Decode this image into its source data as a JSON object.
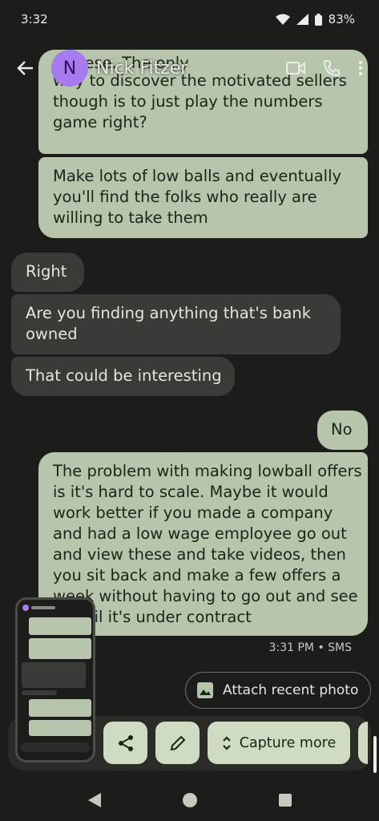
{
  "status": {
    "time": "3:32",
    "battery": "83%"
  },
  "header": {
    "avatar_letter": "N",
    "contact_name": "Nick Fitzer"
  },
  "messages": [
    {
      "dir": "out",
      "text": "...the motivated sellers though is to just play the numbers game right?",
      "lines": [
        "way to discover the motivated sellers",
        "though is to just play the numbers",
        "game right?"
      ]
    },
    {
      "dir": "out",
      "lines": [
        "Make lots of low balls and eventually",
        "you'll find the folks who really are",
        "willing to take them"
      ]
    },
    {
      "dir": "in",
      "lines": [
        "Right"
      ]
    },
    {
      "dir": "in",
      "lines": [
        "Are you finding anything that's bank",
        "owned"
      ]
    },
    {
      "dir": "in",
      "lines": [
        "That could be interesting"
      ]
    },
    {
      "dir": "out",
      "lines": [
        "No"
      ]
    },
    {
      "dir": "out",
      "lines": [
        "The problem with making lowball offers",
        "is it's hard to scale. Maybe it would",
        "work better if you made a company",
        "and had a low wage employee go out",
        "and view these and take videos, then",
        "you sit back and make a few offers a",
        "week without having to go out and see",
        "it until it's under contract"
      ]
    }
  ],
  "timestamp": "3:31 PM • SMS",
  "suggestion": {
    "label": "Attach recent photo"
  },
  "screenshot_tray": {
    "capture_label": "Capture more"
  },
  "icons": {
    "back": "arrow-left-icon",
    "video": "video-camera-icon",
    "call": "phone-icon",
    "more": "more-vert-icon",
    "image": "image-icon",
    "share": "share-icon",
    "edit": "pencil-icon",
    "expand": "unfold-more-icon"
  },
  "colors": {
    "outgoing_bubble": "#b6c5ab",
    "incoming_bubble": "#3a3b36",
    "avatar": "#a77bf0",
    "background": "#1c1d1a"
  }
}
